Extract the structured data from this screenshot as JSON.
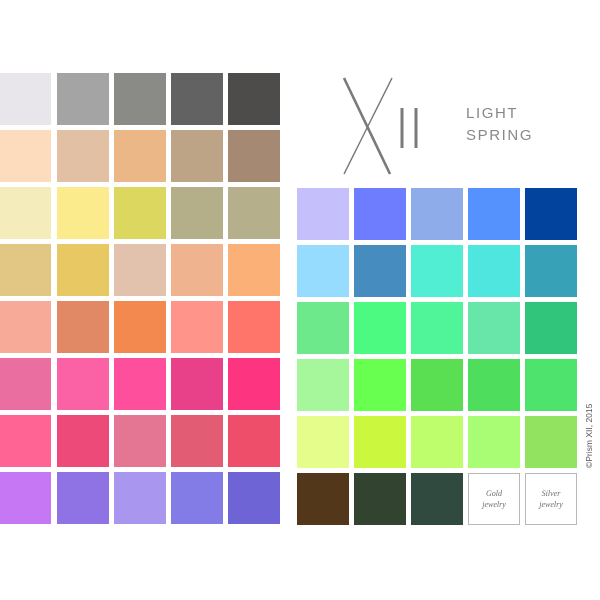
{
  "brand": {
    "mark": "XII",
    "title_line1": "LIGHT",
    "title_line2": "SPRING"
  },
  "copyright": "©Prism XII, 2015",
  "left_palette": [
    [
      "#e8e6ea",
      "#a4a4a4",
      "#8a8a86",
      "#626262",
      "#4e4b4b"
    ],
    [
      "#fddcbd",
      "#e1c0a4",
      "#ebb787",
      "#bea487",
      "#a58972"
    ],
    [
      "#f4edbb",
      "#fceb8c",
      "#dcd75f",
      "#b4af88",
      "#b5b08b"
    ],
    [
      "#e2c684",
      "#e7c862",
      "#e2c2ad",
      "#efb38f",
      "#fbb077"
    ],
    [
      "#f7aa97",
      "#e18964",
      "#f3894e",
      "#ff958a",
      "#ff756a"
    ],
    [
      "#ea6e9f",
      "#fb62a6",
      "#fe4f9d",
      "#e9408a",
      "#fd347f"
    ],
    [
      "#ff6495",
      "#ed4a79",
      "#e57693",
      "#e25d74",
      "#ee4e69"
    ],
    [
      "#c577f4",
      "#8f72e4",
      "#a997ef",
      "#837ce6",
      "#6e64d6"
    ]
  ],
  "right_palette": [
    [
      "#c5c0fc",
      "#6e7dfe",
      "#8eabea",
      "#5692fe",
      "#01439d"
    ],
    [
      "#95dcfe",
      "#468cbe",
      "#51eed3",
      "#50e6e0",
      "#37a1b7"
    ],
    [
      "#6de88b",
      "#4cfa82",
      "#50f59a",
      "#68e5a9",
      "#30c57b"
    ],
    [
      "#a6f79b",
      "#69ff51",
      "#59df51",
      "#4edd5d",
      "#4de36c"
    ],
    [
      "#e5fd8a",
      "#cbf83e",
      "#befe6d",
      "#a8fd75",
      "#92e460"
    ],
    [
      "#52371b",
      "#32442f",
      "#314a40",
      "#ffffff",
      "#ffffff"
    ]
  ],
  "jewelry": {
    "gold": "Gold\njewelry",
    "silver": "Silver\njewelry"
  }
}
